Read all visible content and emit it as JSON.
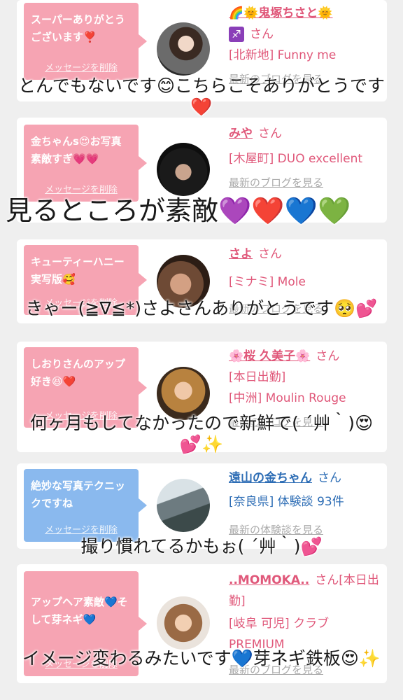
{
  "cards": [
    {
      "bubble": "スーパーありがとうございます❣️",
      "delete_label": "メッセージを削除",
      "name": "🌈🌞鬼塚ちさと🌞",
      "zodiac": "♐",
      "san": "さん",
      "shop": "[北新地] Funny me",
      "recent": "最新のブログを見る",
      "caption": "とんでもないです😊こちらこそありがとうです❤️"
    },
    {
      "bubble": "金ちゃんs😍お写真素敵すぎ💗💗",
      "delete_label": "メッセージを削除",
      "name": "みや",
      "san": "さん",
      "shop": "[木屋町] DUO excellent",
      "recent": "最新のブログを見る",
      "caption": "見るところが素敵💜❤️💙💚"
    },
    {
      "bubble": "キューティーハニー実写版🥰",
      "delete_label": "メッセージを削除",
      "name": "さよ",
      "san": "さん",
      "shop": "[ミナミ] Mole",
      "recent": "最新のブログを見る",
      "caption": "きゃー(≧∇≦*)さよさんありがとうです🥺💕"
    },
    {
      "bubble": "しおりさんのアップ好き😆❤️",
      "delete_label": "メッセージを削除",
      "name": "🌸桜 久美子🌸",
      "san": "さん",
      "shop1": "[本日出勤]",
      "shop": "[中洲] Moulin Rouge",
      "recent": "最新のブログを見る",
      "caption": "何ヶ月もしてなかったので新鮮で( ´艸｀)😍💕✨"
    },
    {
      "bubble": "絶妙な写真テクニックですね",
      "delete_label": "メッセージを削除",
      "name": "遠山の金ちゃん",
      "san": "さん",
      "shop": "[奈良県] 体験談 93件",
      "recent": "最新の体験談を見る",
      "caption": "撮り慣れてるかもぉ( ´艸｀)💕"
    },
    {
      "bubble": "アップヘア素敵💙そして芽ネギ💙",
      "delete_label": "メッセージを削除",
      "name": "..MOMOKA..",
      "san": "さん[本日出勤]",
      "shop": "[岐阜 可児] クラブPREMIUM",
      "recent": "最新のブログを見る",
      "caption": "イメージ変わるみたいです💙芽ネギ鉄板😍✨"
    }
  ]
}
